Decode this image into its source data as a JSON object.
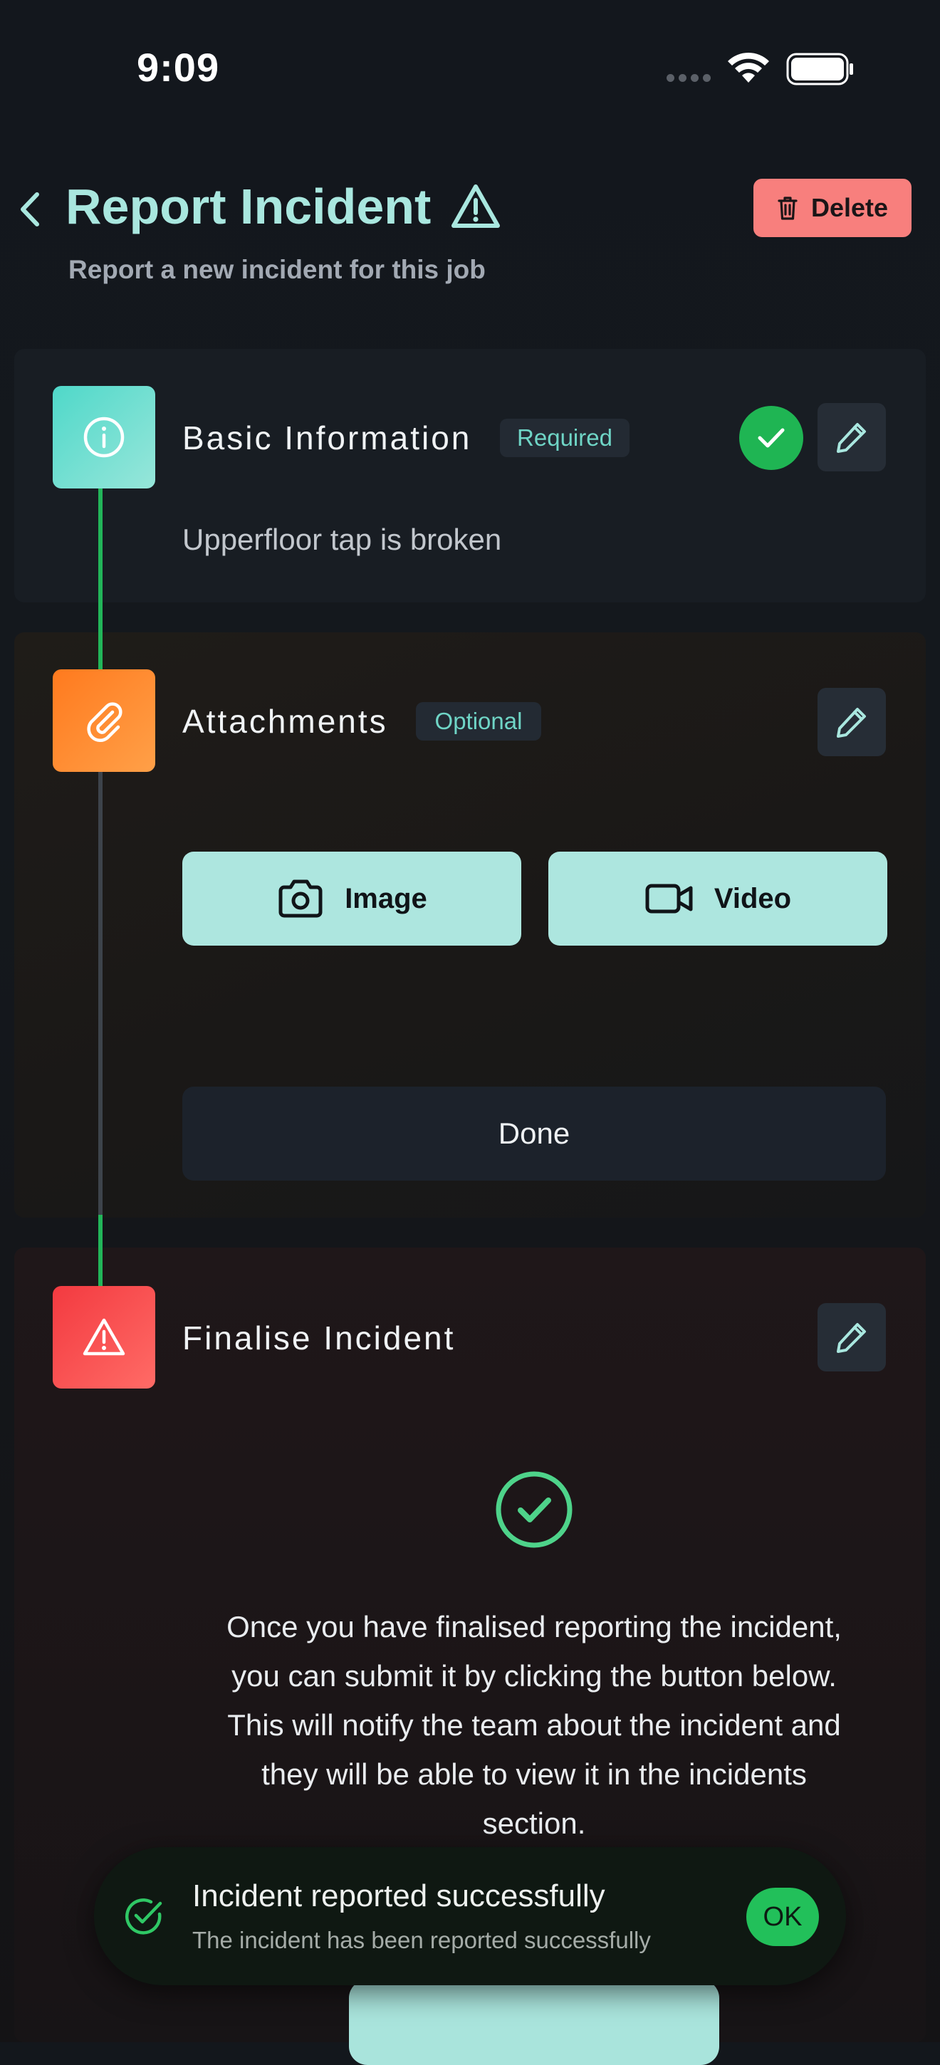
{
  "status_bar": {
    "time": "9:09"
  },
  "header": {
    "title": "Report Incident",
    "subtitle": "Report a new incident for this job",
    "delete_label": "Delete"
  },
  "steps": {
    "basic": {
      "title": "Basic Information",
      "badge": "Required",
      "description": "Upperfloor tap is broken"
    },
    "attachments": {
      "title": "Attachments",
      "badge": "Optional",
      "image_label": "Image",
      "video_label": "Video",
      "done_label": "Done"
    },
    "finalise": {
      "title": "Finalise Incident",
      "message": "Once you have finalised reporting the incident, you can submit it by clicking the button below. This will notify the team about the incident and they will be able to view it in the incidents section."
    }
  },
  "toast": {
    "title": "Incident reported successfully",
    "message": "The incident has been reported successfully",
    "ok_label": "OK"
  },
  "colors": {
    "accent": "#a9e7df",
    "success": "#22c05a",
    "danger": "#f87f7d",
    "attachments_step": "#ff8a2a",
    "finalise_step": "#f5474c"
  }
}
